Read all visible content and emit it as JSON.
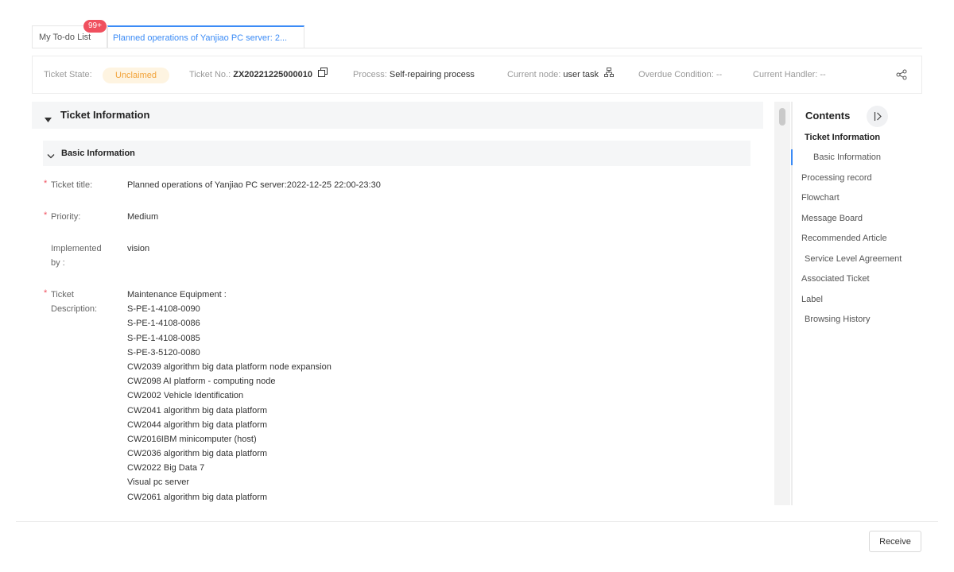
{
  "tabs": {
    "todo_label": "My To-do List",
    "todo_badge": "99+",
    "planned_label": "Planned operations of Yanjiao PC server: 2..."
  },
  "status": {
    "state_label": "Ticket State:",
    "state_value": "Unclaimed",
    "ticket_no_label": "Ticket No.:",
    "ticket_no_value": "ZX20221225000010",
    "process_label": "Process:",
    "process_value": "Self-repairing process",
    "node_label": "Current node:",
    "node_value": "user task",
    "overdue_label": "Overdue Condition:",
    "overdue_value": "--",
    "handler_label": "Current Handler:",
    "handler_value": "--",
    "icons": [
      "copy-icon",
      "flow-node-icon",
      "share-icon"
    ]
  },
  "main": {
    "section_title": "Ticket Information",
    "subsection_title": "Basic Information",
    "fields": {
      "title_label": "Ticket title:",
      "title_value": "Planned operations of Yanjiao PC server:2022-12-25 22:00-23:30",
      "priority_label": "Priority:",
      "priority_value": "Medium",
      "implemented_label_1": "Implemented",
      "implemented_label_2": "by :",
      "implemented_value": "vision",
      "desc_label_1": "Ticket",
      "desc_label_2": "Description:",
      "required_mark": "*"
    },
    "description_lines": [
      "Maintenance Equipment :",
      "S-PE-1-4108-0090",
      "S-PE-1-4108-0086",
      "S-PE-1-4108-0085",
      "S-PE-3-5120-0080",
      "CW2039 algorithm big data platform node expansion",
      "CW2098 AI platform - computing node",
      "CW2002 Vehicle Identification",
      "CW2041 algorithm big data platform",
      "CW2044 algorithm big data platform",
      "CW2016IBM minicomputer (host)",
      "CW2036 algorithm big data platform",
      "CW2022 Big Data 7",
      "Visual pc server",
      "CW2061 algorithm big data platform"
    ]
  },
  "contents": {
    "title": "Contents",
    "items": [
      "Ticket Information",
      "Basic Information",
      "Processing record",
      "Flowchart",
      "Message Board",
      "Recommended Article",
      "Service Level Agreement",
      "Associated Ticket",
      "Label",
      "Browsing History"
    ]
  },
  "footer": {
    "receive_label": "Receive"
  },
  "colors": {
    "accent": "#3b8bf6",
    "badge": "#f0505f",
    "unclaimed_bg": "#fef4e1",
    "unclaimed_text": "#f2a33a"
  }
}
